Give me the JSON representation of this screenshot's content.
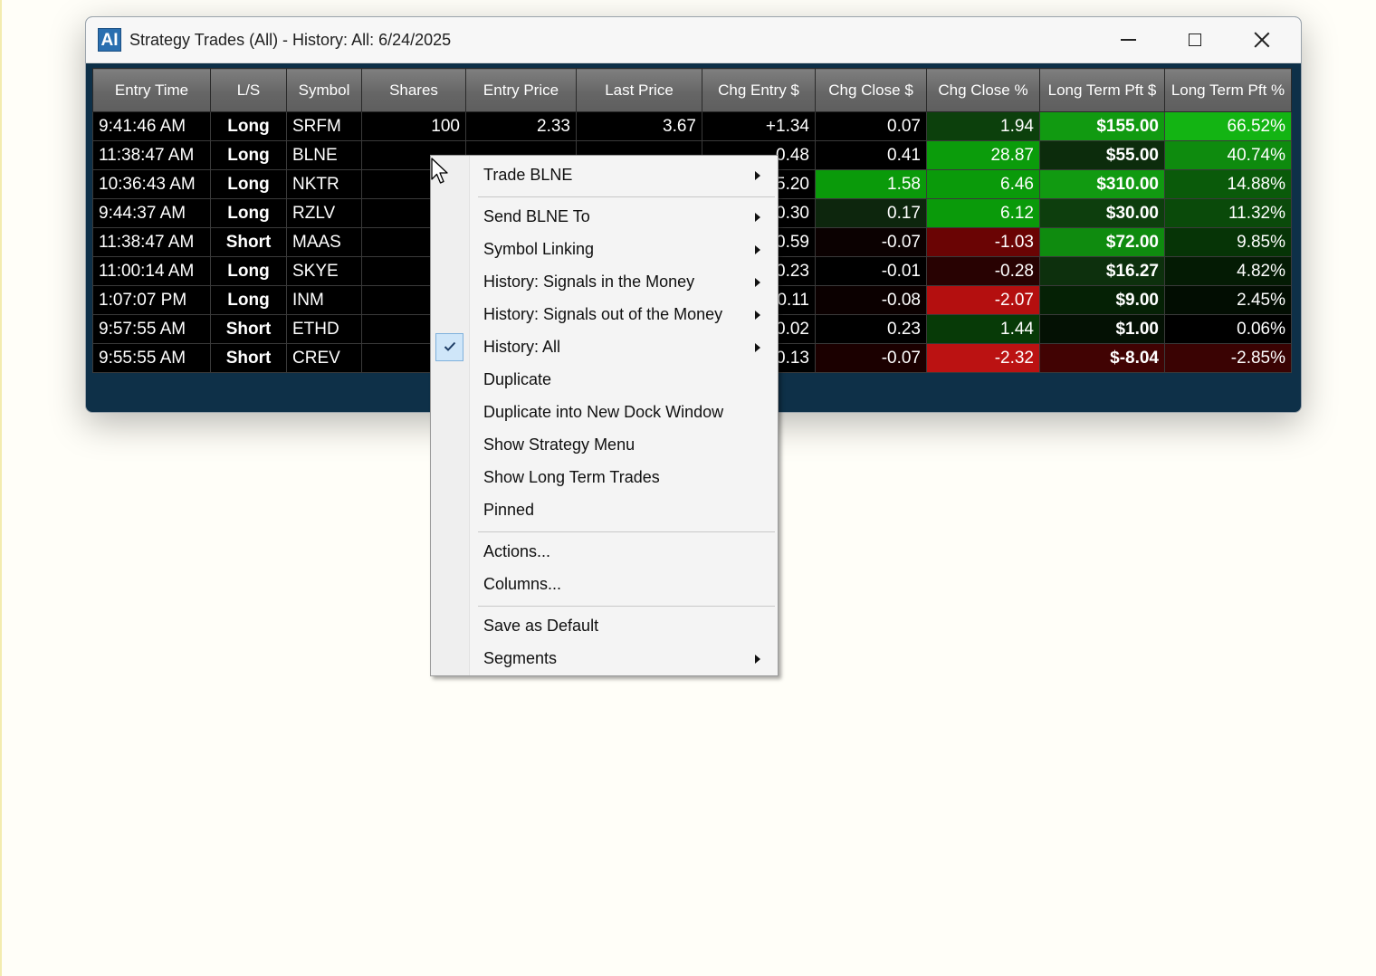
{
  "window": {
    "app_icon": "AI",
    "title": "Strategy Trades (All) - History: All: 6/24/2025",
    "controls": [
      "minimize-icon",
      "maximize-icon",
      "close-icon"
    ]
  },
  "table": {
    "columns": [
      "Entry Time",
      "L/S",
      "Symbol",
      "Shares",
      "Entry Price",
      "Last Price",
      "Chg Entry $",
      "Chg Close $",
      "Chg Close %",
      "Long Term Pft $",
      "Long Term Pft %"
    ],
    "rows": [
      [
        "9:41:46 AM",
        "Long",
        "SRFM",
        "100",
        "2.33",
        "3.67",
        "+1.34",
        "0.07",
        "1.94",
        "$155.00",
        "66.52%"
      ],
      [
        "11:38:47 AM",
        "Long",
        "BLNE",
        "",
        "",
        "",
        "0.48",
        "0.41",
        "28.87",
        "$55.00",
        "40.74%"
      ],
      [
        "10:36:43 AM",
        "Long",
        "NKTR",
        "",
        "",
        "",
        "5.20",
        "1.58",
        "6.46",
        "$310.00",
        "14.88%"
      ],
      [
        "9:44:37 AM",
        "Long",
        "RZLV",
        "",
        "",
        "",
        "0.30",
        "0.17",
        "6.12",
        "$30.00",
        "11.32%"
      ],
      [
        "11:38:47 AM",
        "Short",
        "MAAS",
        "",
        "",
        "",
        "0.59",
        "-0.07",
        "-1.03",
        "$72.00",
        "9.85%"
      ],
      [
        "11:00:14 AM",
        "Long",
        "SKYE",
        "",
        "",
        "",
        "0.23",
        "-0.01",
        "-0.28",
        "$16.27",
        "4.82%"
      ],
      [
        "1:07:07 PM",
        "Long",
        "INM",
        "",
        "",
        "",
        "0.11",
        "-0.08",
        "-2.07",
        "$9.00",
        "2.45%"
      ],
      [
        "9:57:55 AM",
        "Short",
        "ETHD",
        "",
        "",
        "",
        "0.02",
        "0.23",
        "1.44",
        "$1.00",
        "0.06%"
      ],
      [
        "9:55:55 AM",
        "Short",
        "CREV",
        "",
        "",
        "",
        "0.13",
        "-0.07",
        "-2.32",
        "$-8.04",
        "-2.85%"
      ]
    ],
    "colors": {
      "long": "#22e622",
      "short": "#ff1a1a",
      "chg_entry": [
        "pos",
        "pos",
        "pos",
        "pos",
        "neg",
        "pos",
        "pos",
        "neg",
        "neg"
      ],
      "chg_close_bg": [
        "#000000",
        "#000000",
        "#0a9a0a",
        "#0d260d",
        "#0b0101",
        "#000000",
        "#0b0000",
        "#000000",
        "#1b0000"
      ],
      "chg_close_pct_bg": [
        "#0c400c",
        "#0b9c0b",
        "#0a9a0a",
        "#0a9a0a",
        "#6a0404",
        "#280202",
        "#b40f0f",
        "#073a07",
        "#bb1212"
      ],
      "pft_dollar_bg": [
        "#119a11",
        "#0c2c0c",
        "#119a11",
        "#0d3e0d",
        "#0f8b0f",
        "#0d300d",
        "#052105",
        "#041104",
        "#410303"
      ],
      "pft_pct_bg": [
        "#13b413",
        "#0e8b0e",
        "#0a5a0a",
        "#0a4a0a",
        "#063406",
        "#041b04",
        "#020d02",
        "#000000",
        "#3a0303"
      ]
    }
  },
  "context_menu": {
    "groups": [
      [
        {
          "label": "Trade BLNE",
          "submenu": true
        }
      ],
      [
        {
          "label": "Send BLNE To",
          "submenu": true
        },
        {
          "label": "Symbol Linking",
          "submenu": true
        },
        {
          "label": "History: Signals in the Money",
          "submenu": true
        },
        {
          "label": "History: Signals out of the Money",
          "submenu": true
        },
        {
          "label": "History: All",
          "submenu": true,
          "checked": true
        },
        {
          "label": "Duplicate",
          "submenu": false
        },
        {
          "label": "Duplicate into New Dock Window",
          "submenu": false
        },
        {
          "label": "Show Strategy Menu",
          "submenu": false
        },
        {
          "label": "Show Long Term Trades",
          "submenu": false
        },
        {
          "label": "Pinned",
          "submenu": false
        }
      ],
      [
        {
          "label": "Actions...",
          "submenu": false
        },
        {
          "label": "Columns...",
          "submenu": false
        }
      ],
      [
        {
          "label": "Save as Default",
          "submenu": false
        },
        {
          "label": "Segments",
          "submenu": true
        }
      ]
    ]
  }
}
